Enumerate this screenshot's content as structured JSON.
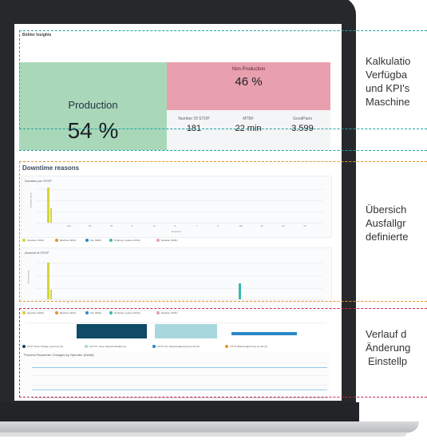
{
  "colors": {
    "teal": "#20a0a0",
    "orange": "#e8902a",
    "crimson": "#c8264a",
    "production": "#a9d8b9",
    "non_production": "#e8a0ae",
    "bar_dark": "#0f4a66",
    "bar_light": "#a8d8de",
    "bar_blue": "#2a88c8",
    "stop_bar": "#d4d43a",
    "maint_bar": "#3ab8b0"
  },
  "app": {
    "logo": "Bühler Insights"
  },
  "kpis": {
    "production_label": "Production",
    "production_value": "54 %",
    "non_production_label": "Non Production",
    "non_production_value": "46 %",
    "stats": [
      {
        "label": "Number Of STOP",
        "value": "181"
      },
      {
        "label": "MTBF",
        "value": "22 min"
      },
      {
        "label": "GoodParts",
        "value": "3.599"
      }
    ]
  },
  "downtime": {
    "title": "Downtime reasons",
    "chart1": {
      "title": "Duration per STOP",
      "ylabel": "Duration (min)",
      "xlabel": "Reasons",
      "counts": [
        "",
        "181",
        "23",
        "19",
        "5",
        "12",
        "8",
        "7",
        "5",
        "180",
        "32",
        "26",
        "16"
      ],
      "legend": [
        "Operator (NOK)",
        "Machine (NOK)",
        "Die (NOK)",
        "Periphery system (NOK)",
        "Variation (NOK)"
      ]
    },
    "chart2": {
      "title": "Amount of STOP",
      "ylabel": "Occurrences",
      "xlabel": "Reasons",
      "counts": [
        "",
        "1",
        "",
        "",
        "",
        "",
        "",
        "",
        "",
        "",
        "",
        "",
        ""
      ],
      "legend": [
        "Operator (NOK)",
        "Machine (NOK)",
        "Die (NOK)",
        "Periphery system (NOK)",
        "Variation (NOK)"
      ]
    }
  },
  "params": {
    "legend": [
      "FZ 67 Temp Vorlage (Lammer) (h)",
      "FZ 6 Pr. Temp Kanal Festhalter (h)",
      "FZ 67 Hm. Werkzeugheizung ein Als (h)",
      "FZ 67 Werkzeugheizung ein Als (h)"
    ],
    "chart_title": "Process Parameter Changes by Operator (Detail)"
  },
  "callouts": [
    {
      "lines": [
        "Kalkulatio",
        "Verfügba",
        "und KPI's",
        "Maschine"
      ]
    },
    {
      "lines": [
        "Übersich",
        "Ausfallgr",
        "definierte"
      ]
    },
    {
      "lines": [
        "Verlauf d",
        "Änderung",
        "Einstellp"
      ]
    }
  ]
}
